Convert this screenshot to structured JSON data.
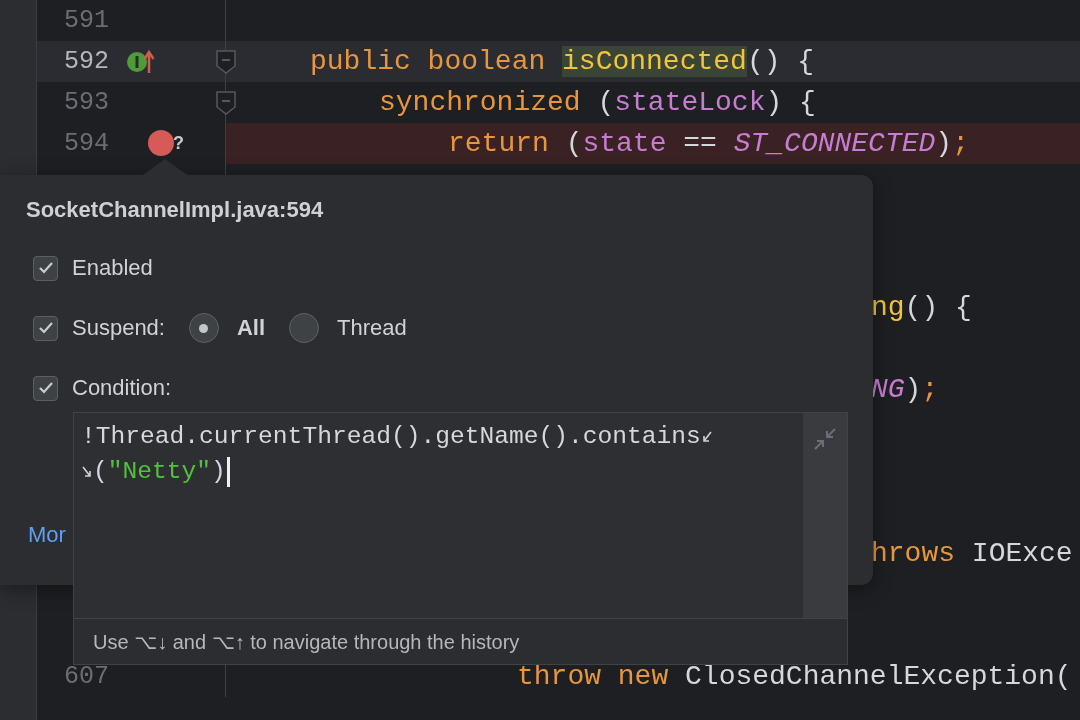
{
  "editor": {
    "lines": [
      {
        "kind": "code",
        "number": "591",
        "current": false,
        "breakpoint": false,
        "fold": false,
        "implements": false
      },
      {
        "kind": "code",
        "number": "592",
        "current": true,
        "breakpoint": false,
        "fold": true,
        "implements": true,
        "tokens": [
          {
            "text": "public boolean ",
            "kind": "keyword"
          },
          {
            "text": "isConnected",
            "kind": "usage"
          },
          {
            "text": "() {",
            "kind": "plain"
          }
        ],
        "children": [
          {
            "kind": "code",
            "number": "593",
            "current": false,
            "breakpoint": false,
            "fold": true,
            "implements": false,
            "tokens": [
              {
                "text": "synchronized ",
                "kind": "keyword"
              },
              {
                "text": "(",
                "kind": "plain"
              },
              {
                "text": "stateLock",
                "kind": "field"
              },
              {
                "text": ") {",
                "kind": "plain"
              }
            ],
            "children": [
              {
                "kind": "code",
                "number": "594",
                "current": false,
                "breakpoint": true,
                "breakpoint_mark": "?",
                "fold": false,
                "implements": false,
                "tokens": [
                  {
                    "text": "return ",
                    "kind": "keyword"
                  },
                  {
                    "text": "(",
                    "kind": "plain"
                  },
                  {
                    "text": "state",
                    "kind": "field"
                  },
                  {
                    "text": " == ",
                    "kind": "plain"
                  },
                  {
                    "text": "ST_CONNECTED",
                    "kind": "constant"
                  },
                  {
                    "text": ")",
                    "kind": "plain"
                  },
                  {
                    "text": ";",
                    "kind": "keyword"
                  }
                ]
              }
            ]
          }
        ]
      },
      {
        "kind": "hidden"
      },
      {
        "kind": "hidden"
      },
      {
        "kind": "hidden"
      },
      {
        "kind": "tail",
        "tokens": [
          {
            "text": "ng",
            "kind": "method"
          },
          {
            "text": "() {",
            "kind": "plain"
          }
        ]
      },
      {
        "kind": "hidden"
      },
      {
        "kind": "tail",
        "tokens": [
          {
            "text": "NG",
            "kind": "constant"
          },
          {
            "text": ")",
            "kind": "plain"
          },
          {
            "text": ";",
            "kind": "keyword"
          }
        ]
      },
      {
        "kind": "hidden"
      },
      {
        "kind": "hidden"
      },
      {
        "kind": "hidden"
      },
      {
        "kind": "tail",
        "tokens": [
          {
            "text": "hrows ",
            "kind": "keyword"
          },
          {
            "text": "IOExce",
            "kind": "plain"
          }
        ],
        "children": [
          {
            "kind": "hidden",
            "children": [
              {
                "kind": "hidden",
                "children": [
                  {
                    "kind": "code",
                    "number": "607",
                    "current": false,
                    "breakpoint": false,
                    "fold": false,
                    "implements": false,
                    "tokens": [
                      {
                        "text": "throw new ",
                        "kind": "keyword"
                      },
                      {
                        "text": "ClosedChannelException(",
                        "kind": "plain"
                      }
                    ]
                  }
                ]
              }
            ]
          }
        ]
      }
    ]
  },
  "popup": {
    "title": "SocketChannelImpl.java:594",
    "enabled": {
      "label": "Enabled",
      "checked": true
    },
    "suspend": {
      "label": "Suspend:",
      "checked": true,
      "options": [
        {
          "label": "All",
          "selected": true
        },
        {
          "label": "Thread",
          "selected": false
        }
      ]
    },
    "condition": {
      "label": "Condition:",
      "checked": true,
      "value_lines": [
        [
          {
            "text": "!Thread.currentThread().getName().contains",
            "kind": "plain"
          }
        ],
        [
          {
            "text": "(",
            "kind": "plain"
          },
          {
            "text": "\"Netty\"",
            "kind": "string"
          },
          {
            "text": ")",
            "kind": "plain"
          }
        ]
      ],
      "hint": "Use ⌥↓ and ⌥↑ to navigate through the history"
    },
    "more_link": "Mor"
  }
}
